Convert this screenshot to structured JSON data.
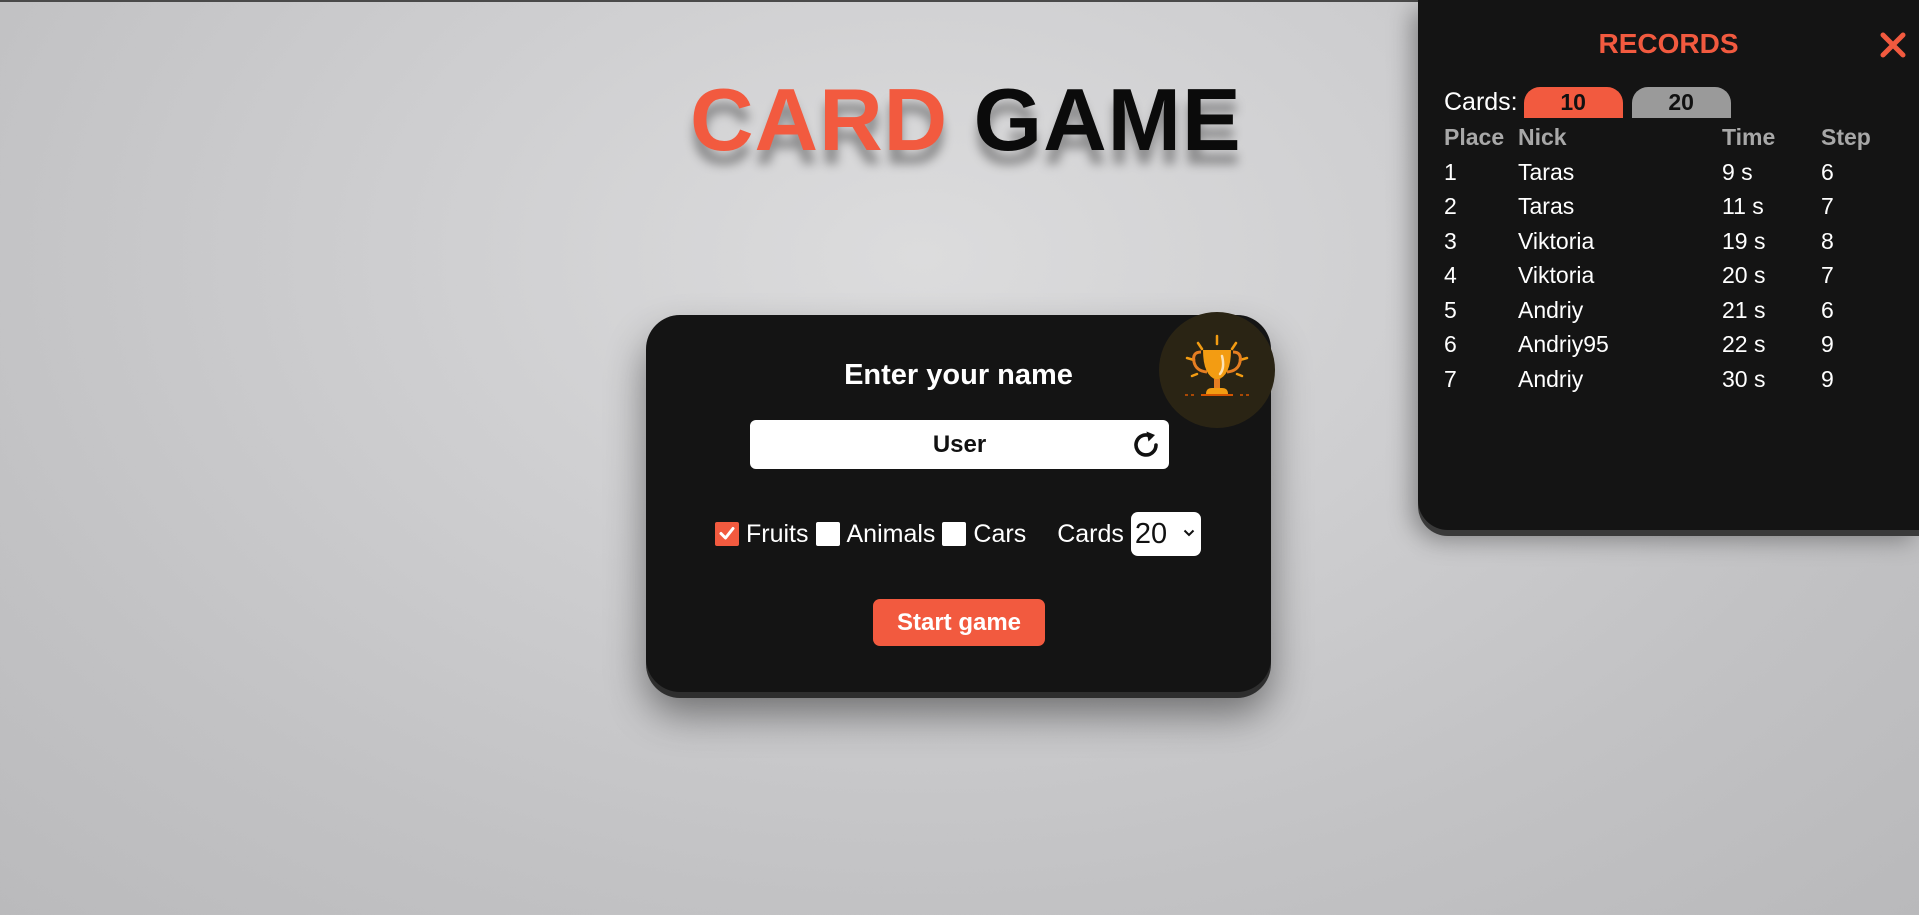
{
  "title": {
    "word1": "CARD",
    "word2": "GAME"
  },
  "menu": {
    "heading": "Enter your name",
    "name_value": "User",
    "options": [
      {
        "label": "Fruits",
        "checked": true
      },
      {
        "label": "Animals",
        "checked": false
      },
      {
        "label": "Cars",
        "checked": false
      }
    ],
    "cards_label": "Cards",
    "cards_selected": "20",
    "start_label": "Start game"
  },
  "records": {
    "title": "RECORDS",
    "cards_label": "Cards:",
    "tabs": [
      {
        "label": "10",
        "active": true
      },
      {
        "label": "20",
        "active": false
      }
    ],
    "columns": {
      "place": "Place",
      "nick": "Nick",
      "time": "Time",
      "step": "Step"
    },
    "rows": [
      {
        "place": "1",
        "nick": "Taras",
        "time": "9 s",
        "step": "6"
      },
      {
        "place": "2",
        "nick": "Taras",
        "time": "11 s",
        "step": "7"
      },
      {
        "place": "3",
        "nick": "Viktoria",
        "time": "19 s",
        "step": "8"
      },
      {
        "place": "4",
        "nick": "Viktoria",
        "time": "20 s",
        "step": "7"
      },
      {
        "place": "5",
        "nick": "Andriy",
        "time": "21 s",
        "step": "6"
      },
      {
        "place": "6",
        "nick": "Andriy95",
        "time": "22 s",
        "step": "9"
      },
      {
        "place": "7",
        "nick": "Andriy",
        "time": "30 s",
        "step": "9"
      }
    ]
  },
  "colors": {
    "accent": "#f25a3f",
    "panel": "#141414",
    "inactive_tab": "#9a9a9a",
    "trophy": "#f39c12"
  },
  "icons": {
    "trophy": "trophy-icon",
    "refresh": "refresh-icon",
    "close": "close-icon",
    "check": "check-icon",
    "dropdown": "chevron-down-icon"
  }
}
